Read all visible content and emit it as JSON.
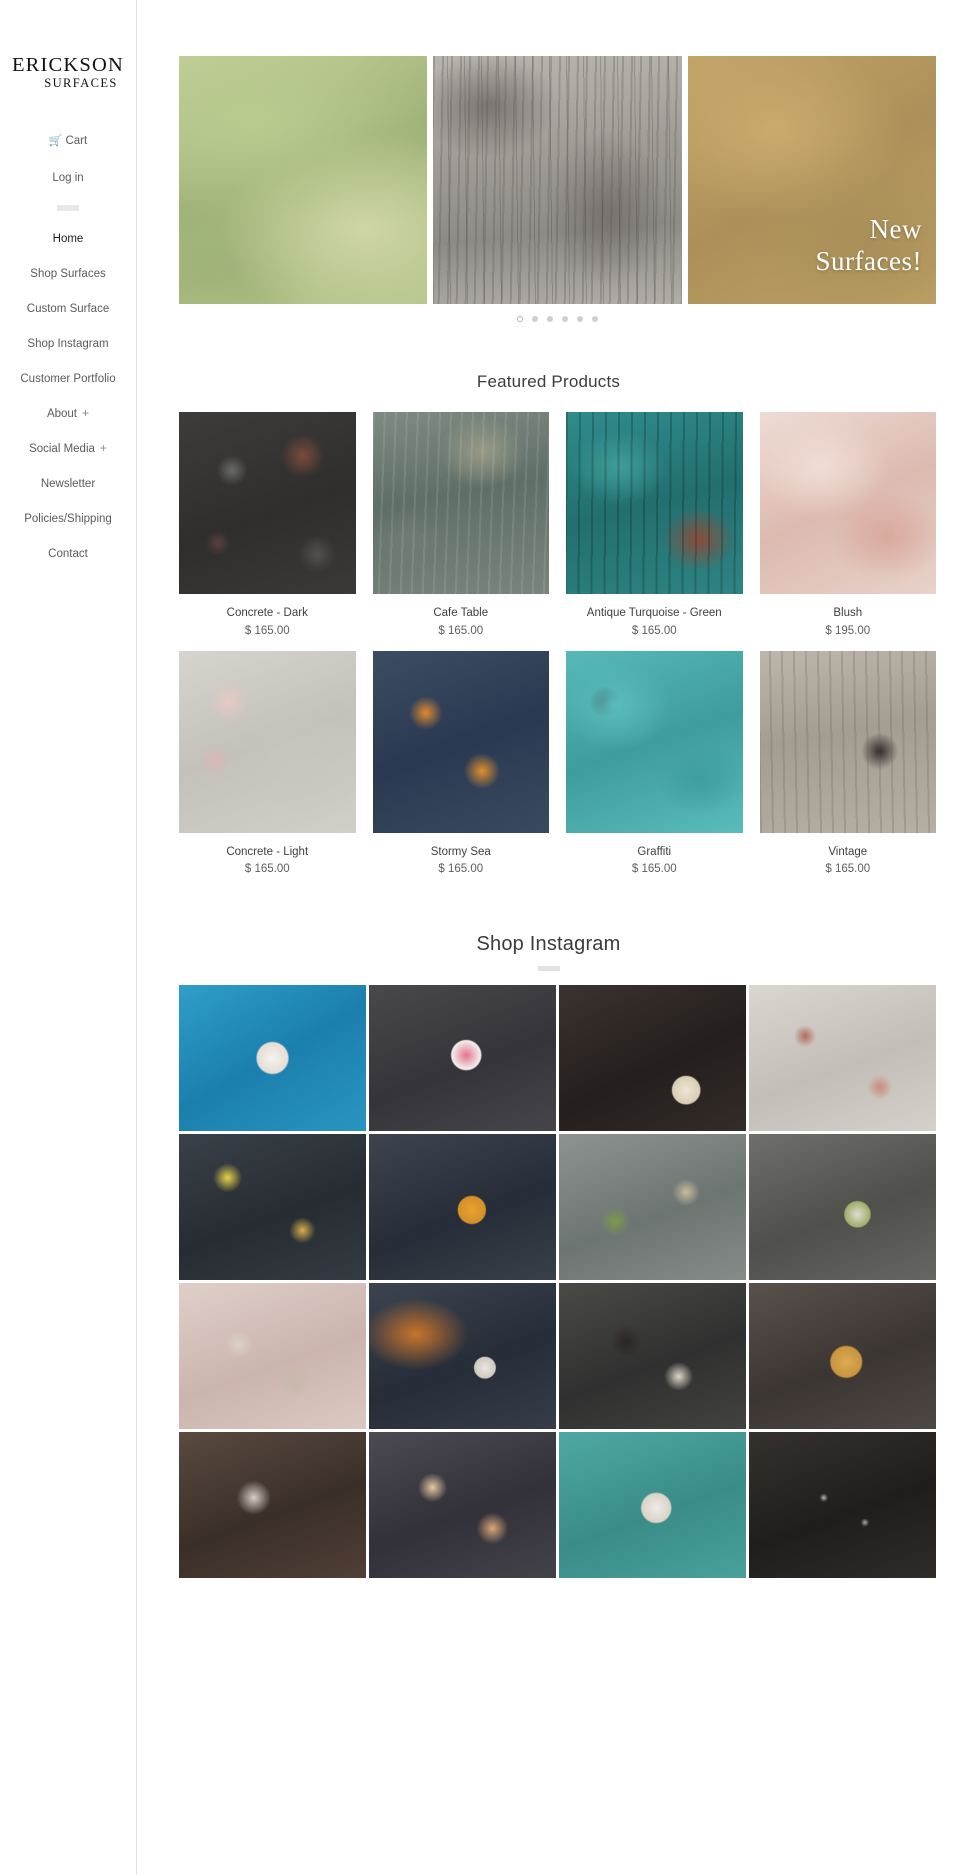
{
  "brand": {
    "name_top": "ERICKSON",
    "name_bottom": "SURFACES"
  },
  "sidebar": {
    "utility": [
      {
        "label": "Cart",
        "icon": "shopping-cart-icon"
      },
      {
        "label": "Log in",
        "icon": ""
      }
    ],
    "nav": [
      {
        "label": "Home",
        "active": true,
        "expand": ""
      },
      {
        "label": "Shop Surfaces",
        "active": false,
        "expand": ""
      },
      {
        "label": "Custom Surface",
        "active": false,
        "expand": ""
      },
      {
        "label": "Shop Instagram",
        "active": false,
        "expand": ""
      },
      {
        "label": "Customer Portfolio",
        "active": false,
        "expand": ""
      },
      {
        "label": "About",
        "active": false,
        "expand": "+"
      },
      {
        "label": "Social Media",
        "active": false,
        "expand": "+"
      },
      {
        "label": "Newsletter",
        "active": false,
        "expand": ""
      },
      {
        "label": "Policies/Shipping",
        "active": false,
        "expand": ""
      },
      {
        "label": "Contact",
        "active": false,
        "expand": ""
      }
    ]
  },
  "hero": {
    "caption_line1": "New",
    "caption_line2": "Surfaces!",
    "slide_count": 6,
    "active_slide": 1,
    "panels": [
      {
        "name": "green-surface"
      },
      {
        "name": "weathered-wood-surface"
      },
      {
        "name": "gold-surface"
      }
    ]
  },
  "featured": {
    "title": "Featured Products",
    "products": [
      {
        "name": "Concrete - Dark",
        "price": "$ 165.00",
        "texture": "t-concrete-dark"
      },
      {
        "name": "Cafe Table",
        "price": "$ 165.00",
        "texture": "t-cafe-table"
      },
      {
        "name": "Antique Turquoise - Green",
        "price": "$ 165.00",
        "texture": "t-turquoise"
      },
      {
        "name": "Blush",
        "price": "$ 195.00",
        "texture": "t-blush"
      },
      {
        "name": "Concrete - Light",
        "price": "$ 165.00",
        "texture": "t-concrete-light"
      },
      {
        "name": "Stormy Sea",
        "price": "$ 165.00",
        "texture": "t-stormy"
      },
      {
        "name": "Graffiti",
        "price": "$ 165.00",
        "texture": "t-graffiti"
      },
      {
        "name": "Vintage",
        "price": "$ 165.00",
        "texture": "t-vintage"
      }
    ]
  },
  "instagram": {
    "title": "Shop Instagram",
    "tiles": [
      {
        "alt": "smoothie-bowl-blue",
        "cls": "ig1"
      },
      {
        "alt": "berry-smoothie-bowl",
        "cls": "ig2"
      },
      {
        "alt": "ramen-bowl-dark",
        "cls": "ig3"
      },
      {
        "alt": "dessert-spread-light",
        "cls": "ig4"
      },
      {
        "alt": "breakfast-board-dark",
        "cls": "ig5"
      },
      {
        "alt": "noodle-bowls-orange",
        "cls": "ig6"
      },
      {
        "alt": "avocado-toast-spread",
        "cls": "ig7"
      },
      {
        "alt": "salad-bowls-overhead",
        "cls": "ig8"
      },
      {
        "alt": "pink-table-setting",
        "cls": "ig9"
      },
      {
        "alt": "fries-and-bowl",
        "cls": "ig10"
      },
      {
        "alt": "dark-berry-bowls",
        "cls": "ig11"
      },
      {
        "alt": "lattice-pie",
        "cls": "ig12"
      },
      {
        "alt": "chocolate-dessert-plate",
        "cls": "ig13"
      },
      {
        "alt": "fruit-cocktails",
        "cls": "ig14"
      },
      {
        "alt": "meringue-bowl-teal",
        "cls": "ig15"
      },
      {
        "alt": "baking-tray-dark",
        "cls": "ig16"
      }
    ]
  }
}
